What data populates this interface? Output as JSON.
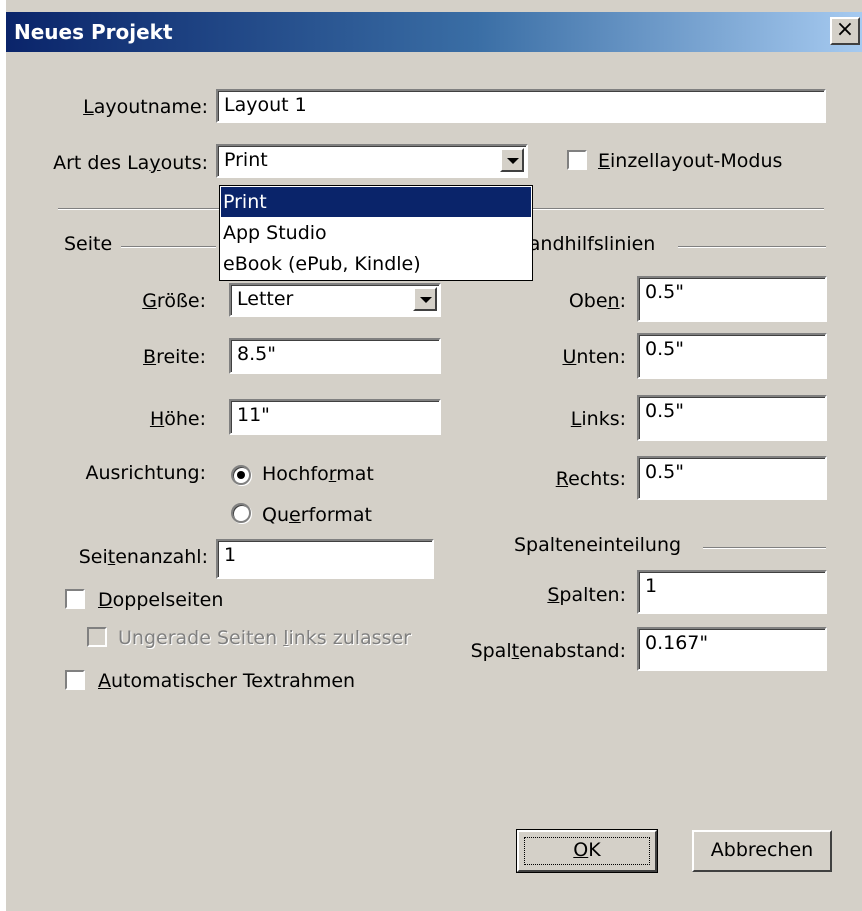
{
  "window": {
    "title": "Neues Projekt",
    "close_symbol": "×"
  },
  "layoutname": {
    "label_a": "",
    "label_ul": "L",
    "label_b": "ayoutname:",
    "value": "Layout 1"
  },
  "layout_type": {
    "label_a": "Art des La",
    "label_ul": "y",
    "label_b": "outs:",
    "value": "Print",
    "options": [
      "Print",
      "App Studio",
      "eBook (ePub, Kindle)"
    ],
    "selected_index": 0
  },
  "single_layout": {
    "label_a": "",
    "label_ul": "E",
    "label_b": "inzellayout-Modus",
    "checked": false
  },
  "page_section": {
    "title": "Seite",
    "size_label_a": "",
    "size_label_ul": "G",
    "size_label_b": "röße:",
    "size_value": "Letter",
    "width_label_a": "",
    "width_label_ul": "B",
    "width_label_b": "reite:",
    "width_value": "8.5\"",
    "height_label_a": "",
    "height_label_ul": "H",
    "height_label_b": "öhe:",
    "height_value": "11\"",
    "orientation_label": "Ausrichtung:",
    "portrait_a": "Hochfo",
    "portrait_ul": "r",
    "portrait_b": "mat",
    "landscape_a": "Qu",
    "landscape_ul": "e",
    "landscape_b": "rformat",
    "orientation_selected": "portrait",
    "pages_label_a": "Sei",
    "pages_label_ul": "t",
    "pages_label_b": "enanzahl:",
    "pages_value": "1",
    "facing_a": "",
    "facing_ul": "D",
    "facing_b": "oppelseiten",
    "facing_checked": false,
    "odd_left_a": "Ungerade Seiten ",
    "odd_left_ul": "l",
    "odd_left_b": "inks zulasser",
    "odd_left_checked": false,
    "auto_text_a": "",
    "auto_text_ul": "A",
    "auto_text_b": "utomatischer Textrahmen",
    "auto_text_checked": false
  },
  "margins_section": {
    "title": "Randhilfslinien",
    "top_label_a": "Obe",
    "top_label_ul": "n",
    "top_label_b": ":",
    "top_value": "0.5\"",
    "bottom_label_a": "",
    "bottom_label_ul": "U",
    "bottom_label_b": "nten:",
    "bottom_value": "0.5\"",
    "left_label_a": "",
    "left_label_ul": "L",
    "left_label_b": "inks:",
    "left_value": "0.5\"",
    "right_label_a": "",
    "right_label_ul": "R",
    "right_label_b": "echts:",
    "right_value": "0.5\""
  },
  "columns_section": {
    "title": "Spalteneinteilung",
    "columns_label_a": "",
    "columns_label_ul": "S",
    "columns_label_b": "palten:",
    "columns_value": "1",
    "gutter_label_a": "Spal",
    "gutter_label_ul": "t",
    "gutter_label_b": "enabstand:",
    "gutter_value": "0.167\""
  },
  "buttons": {
    "ok_ul": "O",
    "ok_b": "K",
    "cancel": "Abbrechen"
  }
}
